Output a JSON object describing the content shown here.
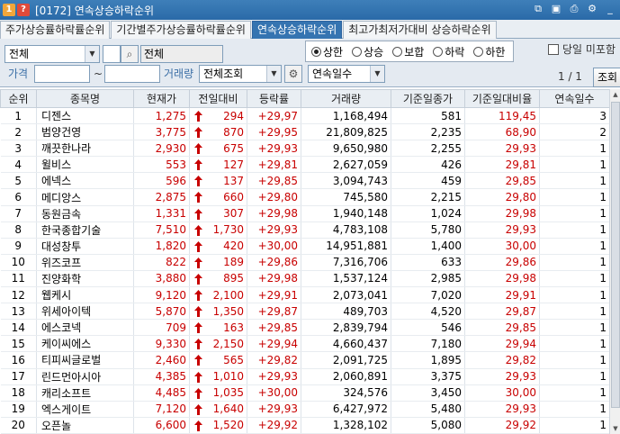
{
  "window": {
    "badge_num": "1",
    "badge_q": "?",
    "title": "[0172] 연속상승하락순위"
  },
  "tabs": [
    {
      "label": "주가상승률하락률순위",
      "active": false
    },
    {
      "label": "기간별주가상승률하락률순위",
      "active": false
    },
    {
      "label": "연속상승하락순위",
      "active": true
    },
    {
      "label": "최고가최저가대비 상승하락순위",
      "active": false
    }
  ],
  "controls": {
    "market_select": "전체",
    "code_select": "",
    "stock_name": "전체",
    "price_label": "가격",
    "price_from": "",
    "price_tilde": "~",
    "price_to": "",
    "volume_label": "거래량",
    "volume_select": "전체조회",
    "radio_options": [
      {
        "label": "상한",
        "checked": true
      },
      {
        "label": "상승",
        "checked": false
      },
      {
        "label": "보합",
        "checked": false
      },
      {
        "label": "하락",
        "checked": false
      },
      {
        "label": "하한",
        "checked": false
      }
    ],
    "sort_select": "연속일수",
    "same_day_label": "당일 미포함",
    "page_indicator": "1 / 1",
    "search_button": "조회"
  },
  "table": {
    "headers": [
      "순위",
      "종목명",
      "현재가",
      "전일대비",
      "등락률",
      "거래량",
      "기준일종가",
      "기준일대비율",
      "연속일수"
    ],
    "rows": [
      {
        "rank": "1",
        "name": "디젠스",
        "price": "1,275",
        "change": "294",
        "rate": "+29,97",
        "volume": "1,168,494",
        "base_close": "581",
        "base_rate": "119,45",
        "days": "3"
      },
      {
        "rank": "2",
        "name": "범양건영",
        "price": "3,775",
        "change": "870",
        "rate": "+29,95",
        "volume": "21,809,825",
        "base_close": "2,235",
        "base_rate": "68,90",
        "days": "2"
      },
      {
        "rank": "3",
        "name": "깨끗한나라",
        "price": "2,930",
        "change": "675",
        "rate": "+29,93",
        "volume": "9,650,980",
        "base_close": "2,255",
        "base_rate": "29,93",
        "days": "1"
      },
      {
        "rank": "4",
        "name": "윌비스",
        "price": "553",
        "change": "127",
        "rate": "+29,81",
        "volume": "2,627,059",
        "base_close": "426",
        "base_rate": "29,81",
        "days": "1"
      },
      {
        "rank": "5",
        "name": "에넥스",
        "price": "596",
        "change": "137",
        "rate": "+29,85",
        "volume": "3,094,743",
        "base_close": "459",
        "base_rate": "29,85",
        "days": "1"
      },
      {
        "rank": "6",
        "name": "메디앙스",
        "price": "2,875",
        "change": "660",
        "rate": "+29,80",
        "volume": "745,580",
        "base_close": "2,215",
        "base_rate": "29,80",
        "days": "1"
      },
      {
        "rank": "7",
        "name": "동원금속",
        "price": "1,331",
        "change": "307",
        "rate": "+29,98",
        "volume": "1,940,148",
        "base_close": "1,024",
        "base_rate": "29,98",
        "days": "1"
      },
      {
        "rank": "8",
        "name": "한국종합기술",
        "price": "7,510",
        "change": "1,730",
        "rate": "+29,93",
        "volume": "4,783,108",
        "base_close": "5,780",
        "base_rate": "29,93",
        "days": "1"
      },
      {
        "rank": "9",
        "name": "대성창투",
        "price": "1,820",
        "change": "420",
        "rate": "+30,00",
        "volume": "14,951,881",
        "base_close": "1,400",
        "base_rate": "30,00",
        "days": "1"
      },
      {
        "rank": "10",
        "name": "위즈코프",
        "price": "822",
        "change": "189",
        "rate": "+29,86",
        "volume": "7,316,706",
        "base_close": "633",
        "base_rate": "29,86",
        "days": "1"
      },
      {
        "rank": "11",
        "name": "진양화학",
        "price": "3,880",
        "change": "895",
        "rate": "+29,98",
        "volume": "1,537,124",
        "base_close": "2,985",
        "base_rate": "29,98",
        "days": "1"
      },
      {
        "rank": "12",
        "name": "웹케시",
        "price": "9,120",
        "change": "2,100",
        "rate": "+29,91",
        "volume": "2,073,041",
        "base_close": "7,020",
        "base_rate": "29,91",
        "days": "1"
      },
      {
        "rank": "13",
        "name": "위세아이텍",
        "price": "5,870",
        "change": "1,350",
        "rate": "+29,87",
        "volume": "489,703",
        "base_close": "4,520",
        "base_rate": "29,87",
        "days": "1"
      },
      {
        "rank": "14",
        "name": "에스코넥",
        "price": "709",
        "change": "163",
        "rate": "+29,85",
        "volume": "2,839,794",
        "base_close": "546",
        "base_rate": "29,85",
        "days": "1"
      },
      {
        "rank": "15",
        "name": "케이씨에스",
        "price": "9,330",
        "change": "2,150",
        "rate": "+29,94",
        "volume": "4,660,437",
        "base_close": "7,180",
        "base_rate": "29,94",
        "days": "1"
      },
      {
        "rank": "16",
        "name": "티피씨글로벌",
        "price": "2,460",
        "change": "565",
        "rate": "+29,82",
        "volume": "2,091,725",
        "base_close": "1,895",
        "base_rate": "29,82",
        "days": "1"
      },
      {
        "rank": "17",
        "name": "린드먼아시아",
        "price": "4,385",
        "change": "1,010",
        "rate": "+29,93",
        "volume": "2,060,891",
        "base_close": "3,375",
        "base_rate": "29,93",
        "days": "1"
      },
      {
        "rank": "18",
        "name": "캐리소프트",
        "price": "4,485",
        "change": "1,035",
        "rate": "+30,00",
        "volume": "324,576",
        "base_close": "3,450",
        "base_rate": "30,00",
        "days": "1"
      },
      {
        "rank": "19",
        "name": "엑스게이트",
        "price": "7,120",
        "change": "1,640",
        "rate": "+29,93",
        "volume": "6,427,972",
        "base_close": "5,480",
        "base_rate": "29,93",
        "days": "1"
      },
      {
        "rank": "20",
        "name": "오픈놀",
        "price": "6,600",
        "change": "1,520",
        "rate": "+29,92",
        "volume": "1,328,102",
        "base_close": "5,080",
        "base_rate": "29,92",
        "days": "1"
      }
    ]
  },
  "colors": {
    "up": "#c80000",
    "active_tab": "#3574b1",
    "titlebar": "#2a6aa8"
  }
}
